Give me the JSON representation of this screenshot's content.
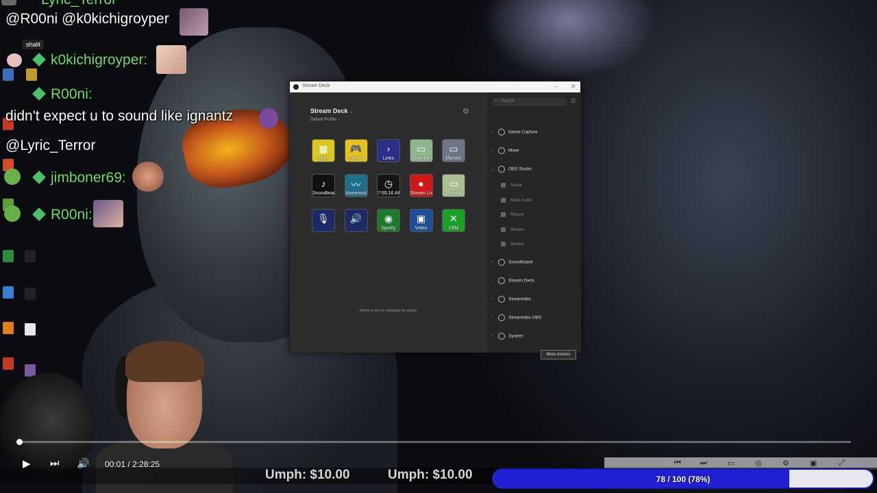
{
  "chat": {
    "top_partial": "Lyric_Terror",
    "lines": [
      {
        "text": "@R00ni @k0kichigroyper"
      },
      {
        "name": "k0kichigroyper:"
      },
      {
        "name": "R00ni:"
      },
      {
        "text": "didn't expect u to sound like ignantz"
      },
      {
        "text": "@Lyric_Terror"
      },
      {
        "name": "jimboner69:"
      },
      {
        "name": "R00ni:"
      }
    ],
    "tooltip": "shalit"
  },
  "stream_deck": {
    "window_title": "Stream Deck",
    "device": "Stream Deck",
    "profile": "Default Profile",
    "hint": "Select a key to configure its action.",
    "search_placeholder": "Search",
    "more_actions": "More Actions",
    "keys": [
      {
        "label": "Apps",
        "color": "#d9c61e",
        "glyph": "▦"
      },
      {
        "label": "Games",
        "color": "#e6c21c",
        "glyph": "🎮"
      },
      {
        "label": "Links",
        "color": "#2c2f8a",
        "glyph": "›"
      },
      {
        "label": "Scenes",
        "color": "#8fb58f",
        "glyph": "▭"
      },
      {
        "label": "Monitor",
        "color": "#6c7888",
        "glyph": "▭"
      },
      {
        "label": "Soundboard",
        "color": "#111111",
        "glyph": "♪"
      },
      {
        "label": "Voicemod",
        "color": "#1f6f8a",
        "glyph": "〰"
      },
      {
        "label": "7:55:16 AM",
        "color": "#151515",
        "glyph": "◷"
      },
      {
        "label": "Stream Live",
        "color": "#d01818",
        "glyph": "●"
      },
      {
        "label": "Monitor",
        "color": "#a8c090",
        "glyph": "▭"
      },
      {
        "label": "",
        "color": "#1c2a66",
        "glyph": "🎙"
      },
      {
        "label": "",
        "color": "#1c2a66",
        "glyph": "🔊"
      },
      {
        "label": "Spotify",
        "color": "#1c7a2c",
        "glyph": "◉"
      },
      {
        "label": "Video",
        "color": "#1f4f9a",
        "glyph": "▣"
      },
      {
        "label": "XBM",
        "color": "#1aa02a",
        "glyph": "✕"
      }
    ],
    "categories": [
      {
        "label": "Game Capture",
        "open": false
      },
      {
        "label": "Mixer",
        "open": false
      },
      {
        "label": "OBS Studio",
        "open": true
      },
      {
        "label": "Soundboard",
        "open": false
      },
      {
        "label": "Stream Deck",
        "open": false
      },
      {
        "label": "Streamlabs",
        "open": false
      },
      {
        "label": "Streamlabs OBS",
        "open": false
      },
      {
        "label": "System",
        "open": false
      }
    ],
    "obs_actions": [
      "Scene",
      "Mixer Audio",
      "Record",
      "Stream",
      "Source"
    ]
  },
  "player": {
    "time_current": "00:01",
    "time_sep": "/",
    "time_total": "2:28:25",
    "progress": 0.004
  },
  "ticker": {
    "items": [
      "Umph: $10.00",
      "Umph: $10.00"
    ]
  },
  "goal": {
    "text": "78 / 100 (78%)",
    "fraction": 0.78
  }
}
